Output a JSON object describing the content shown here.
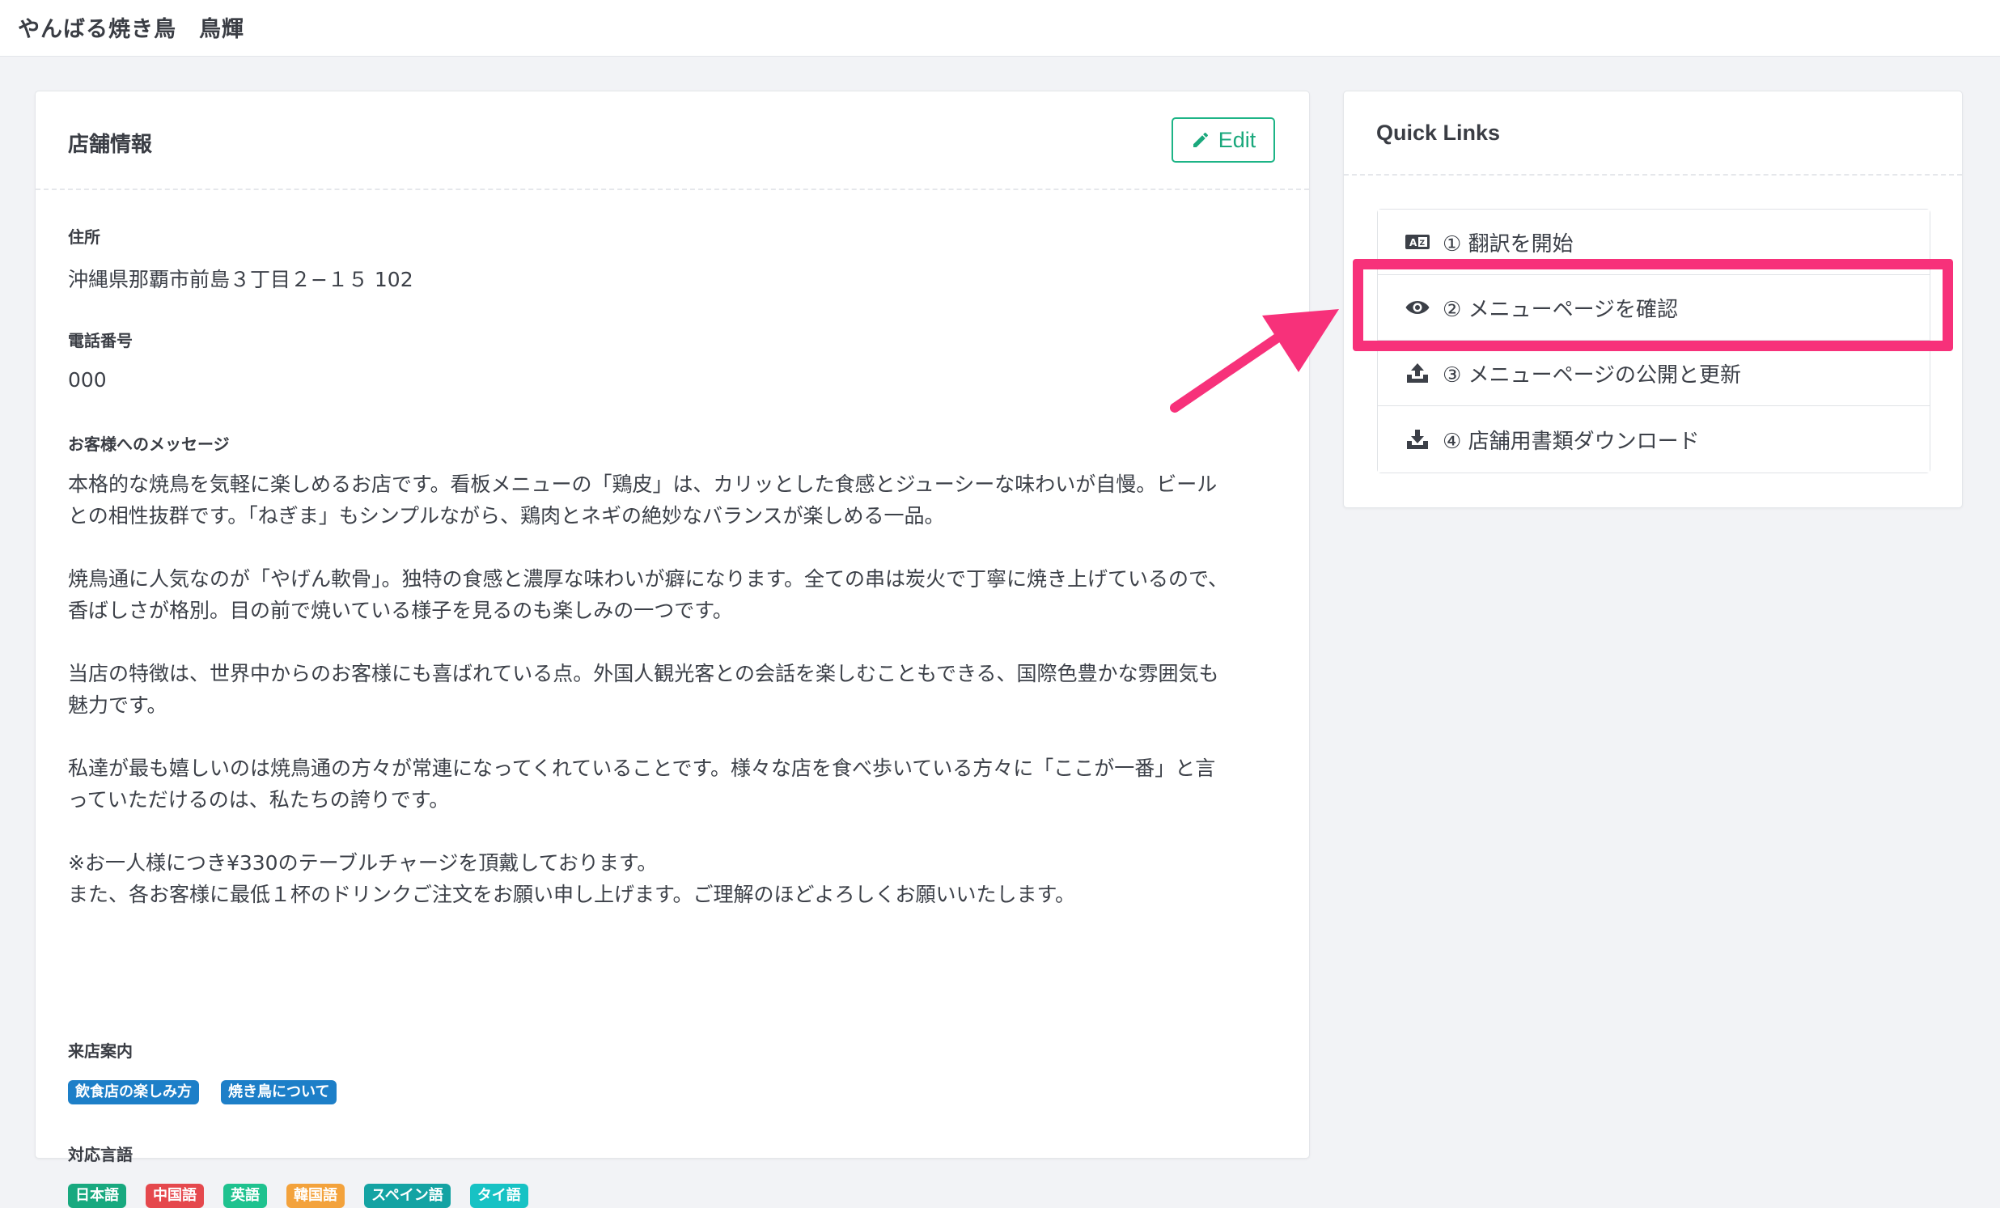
{
  "header": {
    "title": "やんばる焼き鳥　鳥輝"
  },
  "store_info": {
    "card_title": "店舗情報",
    "edit_label": "Edit",
    "address_label": "住所",
    "address": "沖縄県那覇市前島３丁目２−１５ 102",
    "phone_label": "電話番号",
    "phone": "000",
    "message_label": "お客様へのメッセージ",
    "message_lines": [
      "本格的な焼鳥を気軽に楽しめるお店です。看板メニューの「鶏皮」は、カリッとした食感とジューシーな味わいが自慢。ビール",
      "との相性抜群です。「ねぎま」もシンプルながら、鶏肉とネギの絶妙なバランスが楽しめる一品。",
      "焼鳥通に人気なのが「やげん軟骨」。独特の食感と濃厚な味わいが癖になります。全ての串は炭火で丁寧に焼き上げているので、",
      "香ばしさが格別。目の前で焼いている様子を見るのも楽しみの一つです。",
      "当店の特徴は、世界中からのお客様にも喜ばれている点。外国人観光客との会話を楽しむこともできる、国際色豊かな雰囲気も",
      "魅力です。",
      "私達が最も嬉しいのは焼鳥通の方々が常連になってくれていることです。様々な店を食べ歩いている方々に「ここが一番」と言",
      "っていただけるのは、私たちの誇りです。",
      "※お一人様につき¥330のテーブルチャージを頂戴しております。",
      "また、各お客様に最低１杯のドリンクご注文をお願い申し上げます。ご理解のほどよろしくお願いいたします。"
    ],
    "visit_label": "来店案内",
    "visit_badges": [
      "飲食店の楽しみ方",
      "焼き鳥について"
    ],
    "lang_label": "対応言語",
    "languages": [
      {
        "name": "日本語",
        "color": "#18a97f"
      },
      {
        "name": "中国語",
        "color": "#e5484d"
      },
      {
        "name": "英語",
        "color": "#1fc28f"
      },
      {
        "name": "韓国語",
        "color": "#f3a23c"
      },
      {
        "name": "スペイン語",
        "color": "#14a3a3"
      },
      {
        "name": "タイ語",
        "color": "#17c2c4"
      }
    ],
    "visit_badge_color": "#1d7fc8"
  },
  "quick_links": {
    "title": "Quick Links",
    "items": [
      {
        "label": "① 翻訳を開始",
        "icon": "translate-icon"
      },
      {
        "label": "② メニューページを確認",
        "icon": "eye-icon"
      },
      {
        "label": "③ メニューページの公開と更新",
        "icon": "upload-icon"
      },
      {
        "label": "④ 店舗用書類ダウンロード",
        "icon": "download-icon"
      }
    ]
  },
  "colors": {
    "accent": "#1db486",
    "highlight": "#f7317a"
  }
}
